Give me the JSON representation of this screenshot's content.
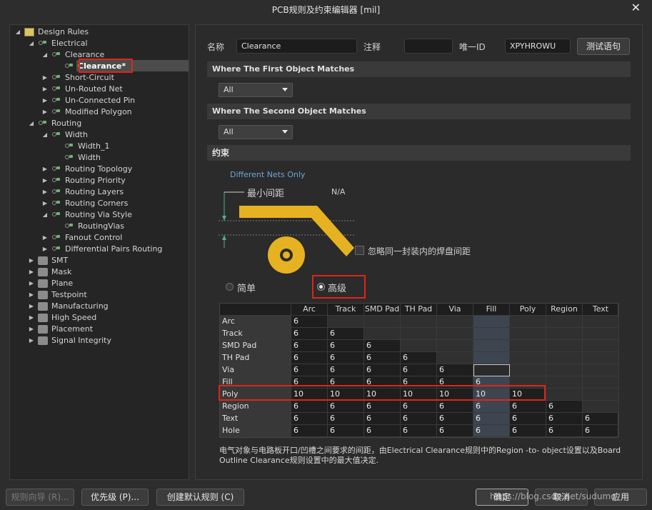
{
  "window": {
    "title": "PCB规则及约束编辑器 [mil]",
    "close_glyph": "✕"
  },
  "tree": [
    {
      "label": "Design Rules",
      "level": 0,
      "expanded": true,
      "icon": "design-rules-icon"
    },
    {
      "label": "Electrical",
      "level": 1,
      "expanded": true,
      "icon": "rule-category-icon"
    },
    {
      "label": "Clearance",
      "level": 2,
      "expanded": true,
      "icon": "rule-icon"
    },
    {
      "label": "Clearance*",
      "level": 3,
      "expanded": null,
      "icon": "rule-icon",
      "selected": true
    },
    {
      "label": "Short-Circuit",
      "level": 2,
      "expanded": false,
      "icon": "rule-icon"
    },
    {
      "label": "Un-Routed Net",
      "level": 2,
      "expanded": false,
      "icon": "rule-icon"
    },
    {
      "label": "Un-Connected Pin",
      "level": 2,
      "expanded": false,
      "icon": "rule-icon"
    },
    {
      "label": "Modified Polygon",
      "level": 2,
      "expanded": false,
      "icon": "rule-icon"
    },
    {
      "label": "Routing",
      "level": 1,
      "expanded": true,
      "icon": "rule-category-icon"
    },
    {
      "label": "Width",
      "level": 2,
      "expanded": true,
      "icon": "rule-icon"
    },
    {
      "label": "Width_1",
      "level": 3,
      "expanded": null,
      "icon": "rule-icon"
    },
    {
      "label": "Width",
      "level": 3,
      "expanded": null,
      "icon": "rule-icon"
    },
    {
      "label": "Routing Topology",
      "level": 2,
      "expanded": false,
      "icon": "rule-icon"
    },
    {
      "label": "Routing Priority",
      "level": 2,
      "expanded": false,
      "icon": "rule-icon"
    },
    {
      "label": "Routing Layers",
      "level": 2,
      "expanded": false,
      "icon": "rule-icon"
    },
    {
      "label": "Routing Corners",
      "level": 2,
      "expanded": false,
      "icon": "rule-icon"
    },
    {
      "label": "Routing Via Style",
      "level": 2,
      "expanded": true,
      "icon": "rule-icon"
    },
    {
      "label": "RoutingVias",
      "level": 3,
      "expanded": null,
      "icon": "rule-icon"
    },
    {
      "label": "Fanout Control",
      "level": 2,
      "expanded": false,
      "icon": "rule-icon"
    },
    {
      "label": "Differential Pairs Routing",
      "level": 2,
      "expanded": false,
      "icon": "rule-icon"
    },
    {
      "label": "SMT",
      "level": 1,
      "expanded": false,
      "icon": "smt-icon"
    },
    {
      "label": "Mask",
      "level": 1,
      "expanded": false,
      "icon": "mask-icon"
    },
    {
      "label": "Plane",
      "level": 1,
      "expanded": false,
      "icon": "plane-icon"
    },
    {
      "label": "Testpoint",
      "level": 1,
      "expanded": false,
      "icon": "testpoint-icon"
    },
    {
      "label": "Manufacturing",
      "level": 1,
      "expanded": false,
      "icon": "manufacturing-icon"
    },
    {
      "label": "High Speed",
      "level": 1,
      "expanded": false,
      "icon": "high-speed-icon"
    },
    {
      "label": "Placement",
      "level": 1,
      "expanded": false,
      "icon": "placement-icon"
    },
    {
      "label": "Signal Integrity",
      "level": 1,
      "expanded": false,
      "icon": "signal-integrity-icon"
    }
  ],
  "header": {
    "name_label": "名称",
    "name_value": "Clearance",
    "comment_label": "注释",
    "comment_value": "",
    "id_label": "唯一ID",
    "id_value": "XPYHROWU",
    "test_button": "测试语句"
  },
  "first_match": {
    "title": "Where The First Object Matches",
    "value": "All"
  },
  "second_match": {
    "title": "Where The Second Object Matches",
    "value": "All"
  },
  "constraints": {
    "title": "约束",
    "net_scope": "Different Nets Only",
    "min_clearance_label": "最小间距",
    "min_clearance_value": "N/A",
    "ignore_pads_label": "忽略同一封装内的焊盘间距",
    "ignore_pads_checked": false,
    "mode_simple": "简单",
    "mode_advanced": "高级",
    "mode_selected": "advanced"
  },
  "matrix": {
    "columns": [
      "Arc",
      "Track",
      "SMD Pad",
      "TH Pad",
      "Via",
      "Fill",
      "Poly",
      "Region",
      "Text"
    ],
    "rows": [
      {
        "name": "Arc",
        "values": [
          "6"
        ]
      },
      {
        "name": "Track",
        "values": [
          "6",
          "6"
        ]
      },
      {
        "name": "SMD Pad",
        "values": [
          "6",
          "6",
          "6"
        ]
      },
      {
        "name": "TH Pad",
        "values": [
          "6",
          "6",
          "6",
          "6"
        ]
      },
      {
        "name": "Via",
        "values": [
          "6",
          "6",
          "6",
          "6",
          "6"
        ]
      },
      {
        "name": "Fill",
        "values": [
          "6",
          "6",
          "6",
          "6",
          "6",
          "6"
        ]
      },
      {
        "name": "Poly",
        "values": [
          "10",
          "10",
          "10",
          "10",
          "10",
          "10",
          "10"
        ]
      },
      {
        "name": "Region",
        "values": [
          "6",
          "6",
          "6",
          "6",
          "6",
          "6",
          "6",
          "6"
        ]
      },
      {
        "name": "Text",
        "values": [
          "6",
          "6",
          "6",
          "6",
          "6",
          "6",
          "6",
          "6",
          "6"
        ]
      },
      {
        "name": "Hole",
        "values": [
          "6",
          "6",
          "6",
          "6",
          "6",
          "6",
          "6",
          "6",
          "6"
        ]
      }
    ]
  },
  "description": "电气对象与电路板开口/凹槽之间要求的间距，由Electrical Clearance规则中的Region -to- object设置以及Board Outline Clearance规则设置中的最大值决定.",
  "footer": {
    "wizard": "规则向导 (R)...",
    "priority": "优先级 (P)...",
    "create_default": "创建默认规则 (C)",
    "ok": "确定",
    "cancel": "取消",
    "apply": "应用",
    "watermark": "https://blog.csdn.net/sudumq"
  },
  "colors": {
    "accent_gold": "#e6b222",
    "highlight_red": "#e0241a"
  }
}
